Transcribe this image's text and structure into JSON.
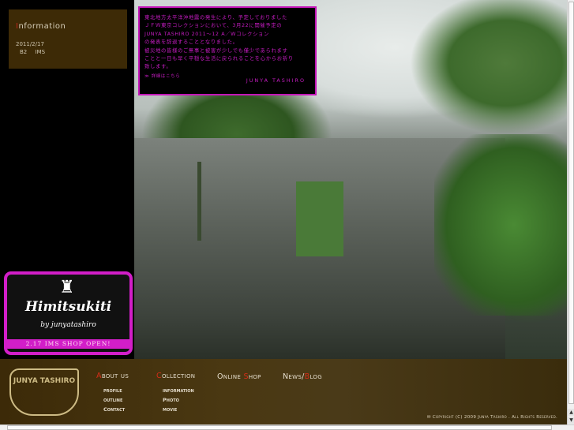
{
  "information": {
    "title": "Information",
    "date": "2011/2/17",
    "entry": "B2 IMS"
  },
  "notice": {
    "lines": [
      "東北地方太平洋沖地震の発生により、予定しておりました",
      "ＪＦＷ東京コレクションにおいて、3月22に開催予定の",
      "JUNYA TASHIRO 2011～12 A／Wコレクション",
      "の発表を辞退することとなりました。",
      "被災地の皆様のご無事と被害が少しでも僅少であられます",
      "ことと一日も早く平穏な生活に戻られることを心からお祈り",
      "致します。"
    ],
    "more": "≫ 詳細はこちら",
    "signature": "JUNYA TASHIRO"
  },
  "banner": {
    "name": "Himitsukiti",
    "by": "by junyatashiro",
    "shop": "2.17 IMS SHOP OPEN!"
  },
  "footer": {
    "logo": "JUNYA TASHIRO",
    "nav": [
      {
        "first": "A",
        "rest": "bout us",
        "subs": [
          "profile",
          "outline",
          "Contact"
        ]
      },
      {
        "first": "C",
        "rest": "ollection",
        "subs": [
          "information",
          "Photo",
          "movie"
        ]
      },
      {
        "pre": "Online ",
        "first": "S",
        "rest": "hop"
      },
      {
        "pre": "News/",
        "first": "B",
        "rest": "log"
      }
    ],
    "copyright": "Copyright (C) 2009 Junya Tashiro . All Rights Reserved."
  }
}
